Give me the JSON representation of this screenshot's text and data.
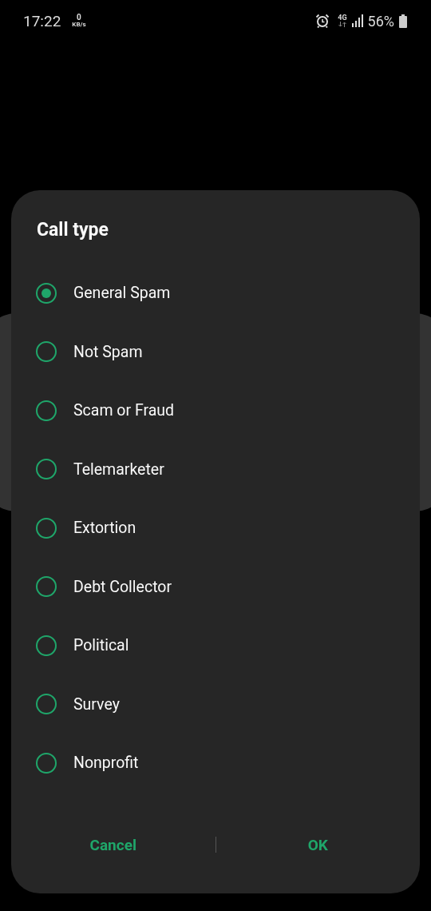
{
  "status_bar": {
    "time": "17:22",
    "speed_value": "0",
    "speed_unit": "KB/s",
    "network": "4G",
    "battery": "56%"
  },
  "dialog": {
    "title": "Call type",
    "options": [
      {
        "label": "General Spam",
        "selected": true
      },
      {
        "label": "Not Spam",
        "selected": false
      },
      {
        "label": "Scam or Fraud",
        "selected": false
      },
      {
        "label": "Telemarketer",
        "selected": false
      },
      {
        "label": "Extortion",
        "selected": false
      },
      {
        "label": "Debt Collector",
        "selected": false
      },
      {
        "label": "Political",
        "selected": false
      },
      {
        "label": "Survey",
        "selected": false
      },
      {
        "label": "Nonprofit",
        "selected": false
      }
    ],
    "buttons": [
      "Cancel",
      "OK"
    ]
  }
}
